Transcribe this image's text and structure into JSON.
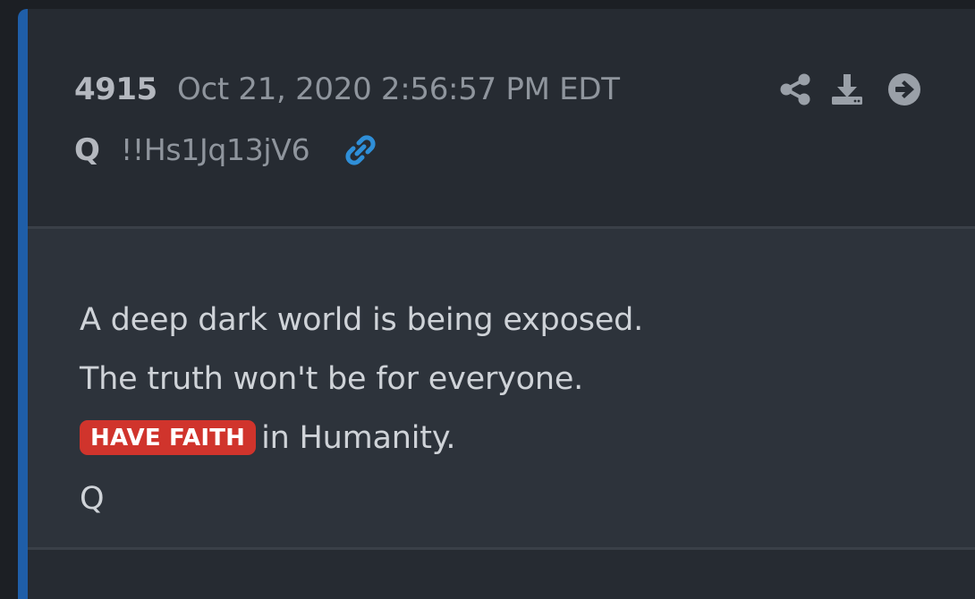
{
  "post": {
    "number": "4915",
    "date": "Oct 21, 2020 2:56:57 PM EDT",
    "author": "Q",
    "tripcode": "!!Hs1Jq13jV6"
  },
  "icons": {
    "link": "link-icon",
    "share": "share-icon",
    "download": "download-icon",
    "next": "arrow-right-circle-icon"
  },
  "message": {
    "line1": "A deep dark world is being exposed.",
    "line2": "The truth won't be for everyone.",
    "badge": "HAVE FAITH",
    "line3_rest": "in Humanity.",
    "signature": "Q"
  },
  "colors": {
    "accent_border": "#1f5ea8",
    "badge_bg": "#d0342c",
    "link_icon": "#2f8fd8",
    "background": "#1c1f24"
  }
}
